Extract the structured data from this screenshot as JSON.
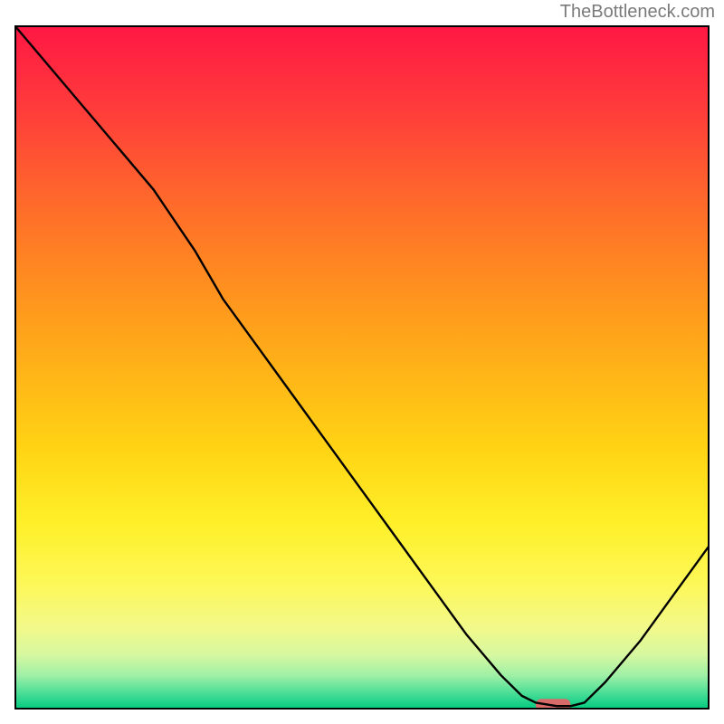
{
  "watermark": "TheBottleneck.com",
  "chart_data": {
    "type": "line",
    "title": "",
    "xlabel": "",
    "ylabel": "",
    "xlim": [
      0,
      100
    ],
    "ylim": [
      0,
      100
    ],
    "grid": false,
    "x": [
      0,
      5,
      10,
      15,
      20,
      22,
      26,
      30,
      35,
      40,
      45,
      50,
      55,
      60,
      65,
      70,
      73,
      75,
      78,
      80,
      82,
      85,
      90,
      95,
      100
    ],
    "y": [
      100,
      94,
      88,
      82,
      76,
      73,
      67,
      60,
      53,
      46,
      39,
      32,
      25,
      18,
      11,
      5,
      2,
      1,
      0.5,
      0.5,
      1,
      4,
      10,
      17,
      24
    ],
    "marker": {
      "x_start": 75,
      "x_end": 80,
      "y": 0.7,
      "color": "#d96a6a",
      "shape": "capsule"
    },
    "background_gradient": {
      "top": "#ff1744",
      "middle": "#ffd414",
      "bottom": "#00c97f"
    }
  }
}
